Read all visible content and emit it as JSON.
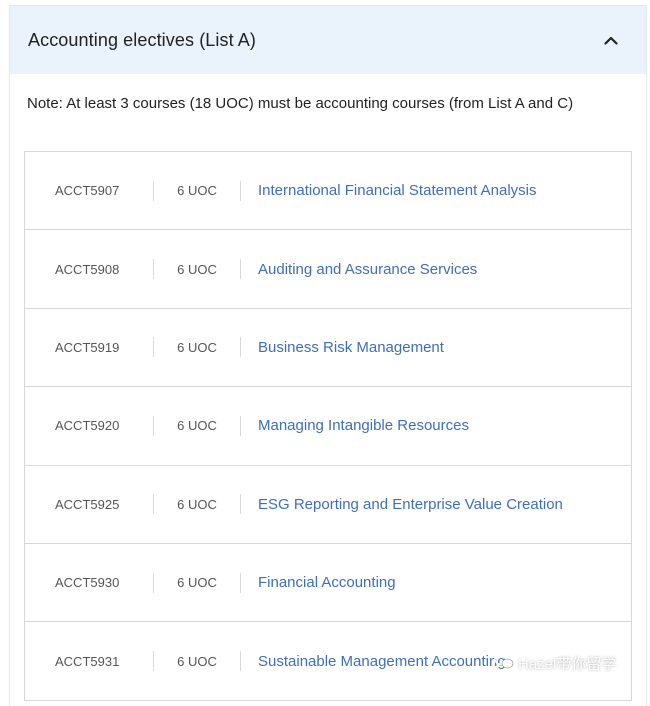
{
  "section": {
    "title": "Accounting electives (List A)",
    "toggle_icon": "chevron-up-icon",
    "note": "Note: At least 3 courses (18 UOC) must be accounting courses (from List A and C)"
  },
  "courses": [
    {
      "code": "ACCT5907",
      "uoc": "6 UOC",
      "name": "International Financial Statement Analysis"
    },
    {
      "code": "ACCT5908",
      "uoc": "6 UOC",
      "name": "Auditing and Assurance Services"
    },
    {
      "code": "ACCT5919",
      "uoc": "6 UOC",
      "name": "Business Risk Management"
    },
    {
      "code": "ACCT5920",
      "uoc": "6 UOC",
      "name": "Managing Intangible Resources"
    },
    {
      "code": "ACCT5925",
      "uoc": "6 UOC",
      "name": "ESG Reporting and Enterprise Value Creation"
    },
    {
      "code": "ACCT5930",
      "uoc": "6 UOC",
      "name": "Financial Accounting"
    },
    {
      "code": "ACCT5931",
      "uoc": "6 UOC",
      "name": "Sustainable Management Accounting"
    }
  ],
  "watermark": {
    "text": "Hazel带你留学",
    "icon": "wechat-icon"
  },
  "colors": {
    "header_bg": "#eaf3fb",
    "link": "#3f6fb5",
    "border": "#d4d7db"
  }
}
